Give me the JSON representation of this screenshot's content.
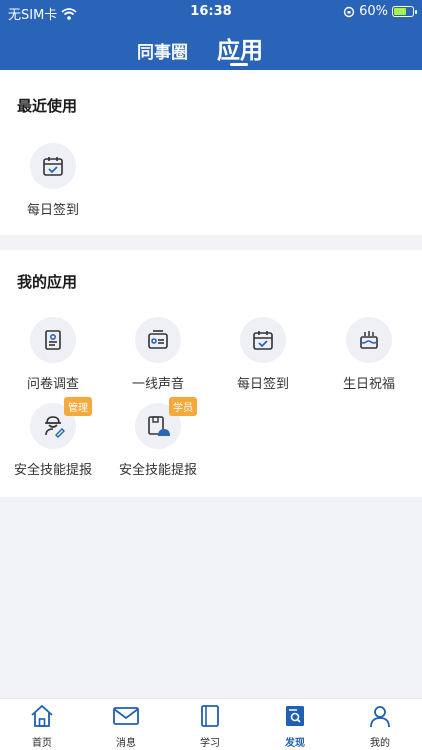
{
  "status_bar": {
    "carrier": "无SIM卡",
    "time": "16:38",
    "battery": "60%"
  },
  "tabs": [
    {
      "label": "同事圈",
      "active": false
    },
    {
      "label": "应用",
      "active": true
    }
  ],
  "recent": {
    "title": "最近使用",
    "items": [
      {
        "label": "每日签到",
        "icon": "calendar-check-icon"
      }
    ]
  },
  "my_apps": {
    "title": "我的应用",
    "items": [
      {
        "label": "问卷调查",
        "icon": "questionnaire-icon"
      },
      {
        "label": "一线声音",
        "icon": "inbox-icon"
      },
      {
        "label": "每日签到",
        "icon": "calendar-check-icon"
      },
      {
        "label": "生日祝福",
        "icon": "birthday-cake-icon"
      },
      {
        "label": "安全技能提报",
        "icon": "worker-edit-icon",
        "badge": "管理"
      },
      {
        "label": "安全技能提报",
        "icon": "helmet-book-icon",
        "badge": "学员"
      }
    ]
  },
  "tabbar": [
    {
      "label": "首页",
      "icon": "home-icon",
      "active": false
    },
    {
      "label": "消息",
      "icon": "envelope-icon",
      "active": false
    },
    {
      "label": "学习",
      "icon": "book-icon",
      "active": false
    },
    {
      "label": "发现",
      "icon": "discover-icon",
      "active": true
    },
    {
      "label": "我的",
      "icon": "user-icon",
      "active": false
    }
  ],
  "colors": {
    "primary": "#2a64b8",
    "badge": "#f3a93b",
    "icon_bg": "#eef0f6",
    "active_tab": "#1f5fb4"
  }
}
